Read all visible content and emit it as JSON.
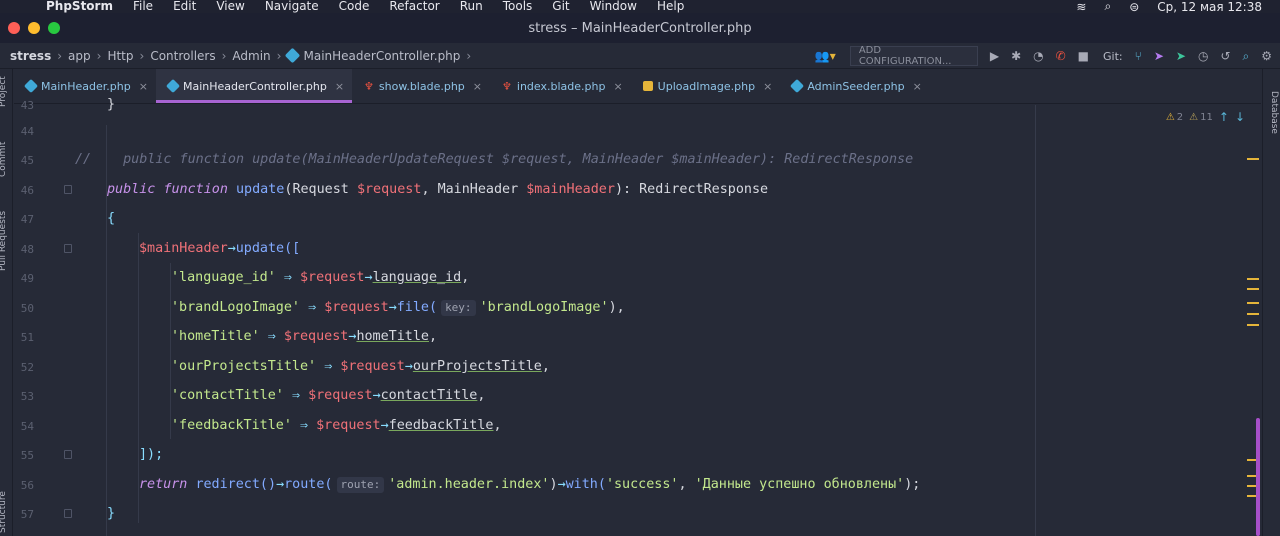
{
  "menubar": {
    "app_name": "PhpStorm",
    "items": [
      "File",
      "Edit",
      "View",
      "Navigate",
      "Code",
      "Refactor",
      "Run",
      "Tools",
      "Git",
      "Window",
      "Help"
    ],
    "clock": "Ср, 12 мая  12:38"
  },
  "window": {
    "title": "stress – MainHeaderController.php"
  },
  "breadcrumb": [
    "stress",
    "app",
    "Http",
    "Controllers",
    "Admin",
    "MainHeaderController.php"
  ],
  "toolbar": {
    "add_configuration": "ADD CONFIGURATION...",
    "git_label": "Git:"
  },
  "left_panels": [
    "Project",
    "Commit",
    "Pull Requests",
    "Structure"
  ],
  "right_panels": [
    "Database"
  ],
  "tabs": [
    {
      "label": "MainHeader.php",
      "color": "#3fa9d8",
      "active": false
    },
    {
      "label": "MainHeaderController.php",
      "color": "#3fa9d8",
      "active": true
    },
    {
      "label": "show.blade.php",
      "color": "#f05340",
      "active": false
    },
    {
      "label": "index.blade.php",
      "color": "#f05340",
      "active": false
    },
    {
      "label": "UploadImage.php",
      "color": "#e5b53a",
      "active": false
    },
    {
      "label": "AdminSeeder.php",
      "color": "#3fa9d8",
      "active": false
    }
  ],
  "inspections": {
    "warnings": "2",
    "weak_warnings": "11"
  },
  "editor": {
    "line_numbers": [
      "43",
      "44",
      "45",
      "46",
      "47",
      "48",
      "49",
      "50",
      "51",
      "52",
      "53",
      "54",
      "55",
      "56",
      "57"
    ],
    "comment_prefix": "//",
    "comment_text": "public function update(MainHeaderUpdateRequest $request, MainHeader $mainHeader): RedirectResponse",
    "kw_public": "public",
    "kw_function": "function",
    "fn_update": "update",
    "type_request": "Request",
    "var_request": "$request",
    "type_mainheader": "MainHeader",
    "var_mainheader": "$mainHeader",
    "return_type": "RedirectResponse",
    "brace_open": "{",
    "brace_close": "}",
    "arrow": "→",
    "fat_arrow": "⇒",
    "update_call": "update([",
    "close_array": "]);",
    "file_fn": "file(",
    "hint_key": "key:",
    "rows": [
      {
        "key": "'language_id'",
        "prop": "language_id"
      },
      {
        "key": "'brandLogoImage'",
        "file_arg": "'brandLogoImage'"
      },
      {
        "key": "'homeTitle'",
        "prop": "homeTitle"
      },
      {
        "key": "'ourProjectsTitle'",
        "prop": "ourProjectsTitle"
      },
      {
        "key": "'contactTitle'",
        "prop": "contactTitle"
      },
      {
        "key": "'feedbackTitle'",
        "prop": "feedbackTitle"
      }
    ],
    "return_kw": "return",
    "redirect_fn": "redirect()",
    "route_fn": "route(",
    "hint_route": "route:",
    "route_arg": "'admin.header.index'",
    "with_fn": "with(",
    "with_arg1": "'success'",
    "with_arg2": "'Данные успешно обновлены'",
    "return_tail": ");"
  }
}
